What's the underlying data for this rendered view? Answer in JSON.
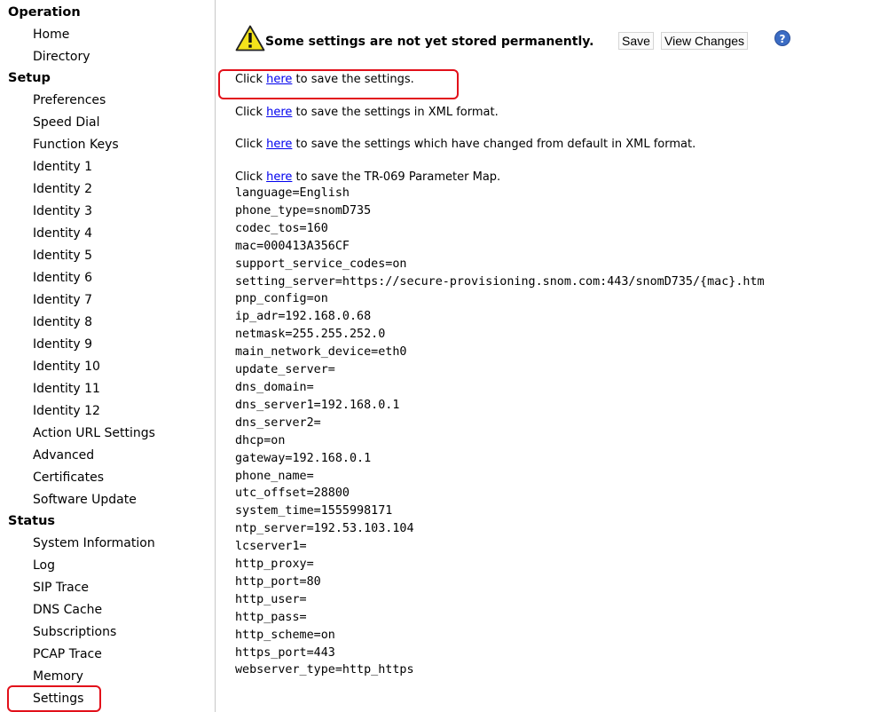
{
  "sidebar": {
    "sections": [
      {
        "heading": "Operation",
        "items": [
          "Home",
          "Directory"
        ]
      },
      {
        "heading": "Setup",
        "items": [
          "Preferences",
          "Speed Dial",
          "Function Keys",
          "Identity 1",
          "Identity 2",
          "Identity 3",
          "Identity 4",
          "Identity 5",
          "Identity 6",
          "Identity 7",
          "Identity 8",
          "Identity 9",
          "Identity 10",
          "Identity 11",
          "Identity 12",
          "Action URL Settings",
          "Advanced",
          "Certificates",
          "Software Update"
        ]
      },
      {
        "heading": "Status",
        "items": [
          "System Information",
          "Log",
          "SIP Trace",
          "DNS Cache",
          "Subscriptions",
          "PCAP Trace",
          "Memory",
          "Settings"
        ]
      }
    ]
  },
  "notice": {
    "text": "Some settings are not yet stored permanently.",
    "save_label": "Save",
    "view_changes_label": "View Changes",
    "help_glyph": "?"
  },
  "save_links": [
    {
      "before": "Click ",
      "link": "here",
      "after": " to save the settings."
    },
    {
      "before": "Click ",
      "link": "here",
      "after": " to save the settings in XML format."
    },
    {
      "before": "Click ",
      "link": "here",
      "after": " to save the settings which have changed from default in XML format."
    },
    {
      "before": "Click ",
      "link": "here",
      "after": " to save the TR-069 Parameter Map."
    }
  ],
  "settings": [
    "language=English",
    "phone_type=snomD735",
    "codec_tos=160",
    "mac=000413A356CF",
    "support_service_codes=on",
    "setting_server=https://secure-provisioning.snom.com:443/snomD735/{mac}.htm",
    "pnp_config=on",
    "ip_adr=192.168.0.68",
    "netmask=255.255.252.0",
    "main_network_device=eth0",
    "update_server=",
    "dns_domain=",
    "dns_server1=192.168.0.1",
    "dns_server2=",
    "dhcp=on",
    "gateway=192.168.0.1",
    "phone_name=",
    "utc_offset=28800",
    "system_time=1555998171",
    "ntp_server=192.53.103.104",
    "lcserver1=",
    "http_proxy=",
    "http_port=80",
    "http_user=",
    "http_pass=",
    "http_scheme=on",
    "https_port=443",
    "webserver_type=http_https"
  ],
  "colors": {
    "highlight": "#e2101a",
    "link": "#0000ee",
    "warning": "#f4e31b"
  }
}
